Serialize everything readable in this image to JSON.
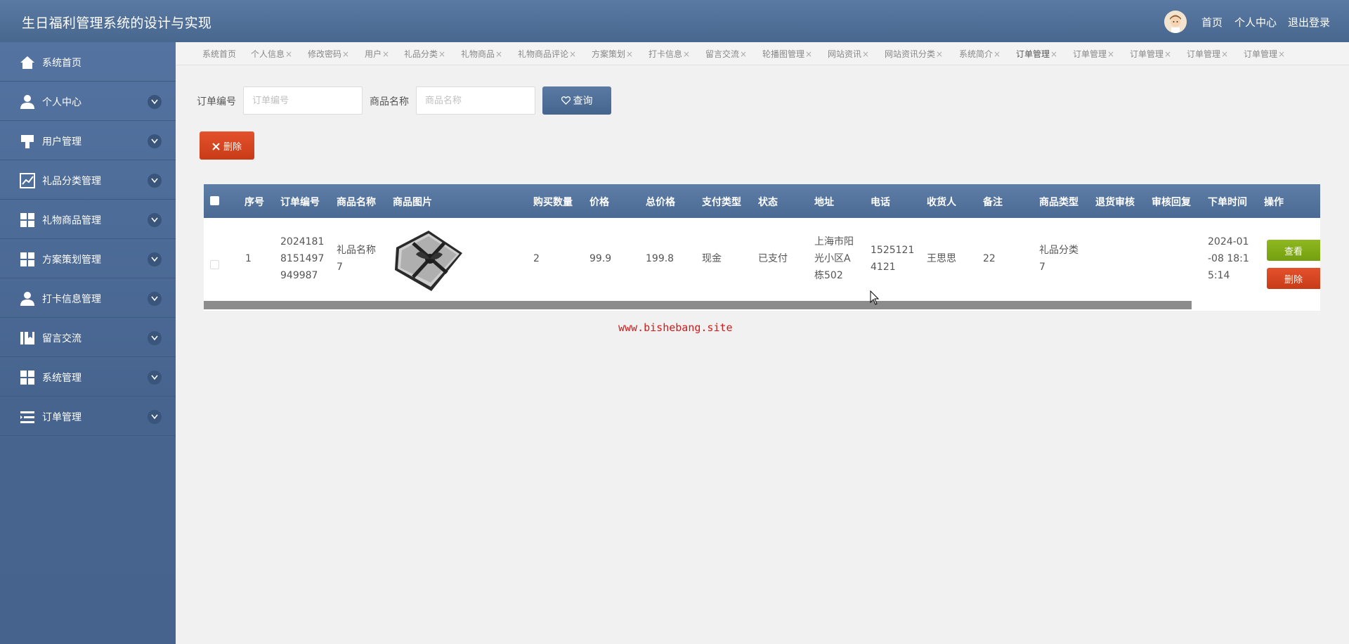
{
  "header": {
    "app_title": "生日福利管理系统的设计与实现",
    "nav": [
      "首页",
      "个人中心",
      "退出登录"
    ]
  },
  "sidebar": {
    "items": [
      {
        "label": "系统首页",
        "icon": "home-icon",
        "expandable": false
      },
      {
        "label": "个人中心",
        "icon": "user-icon",
        "expandable": true
      },
      {
        "label": "用户管理",
        "icon": "brush-icon",
        "expandable": true
      },
      {
        "label": "礼品分类管理",
        "icon": "chart-icon",
        "expandable": true
      },
      {
        "label": "礼物商品管理",
        "icon": "grid-icon",
        "expandable": true
      },
      {
        "label": "方案策划管理",
        "icon": "grid-icon",
        "expandable": true
      },
      {
        "label": "打卡信息管理",
        "icon": "user-icon",
        "expandable": true
      },
      {
        "label": "留言交流",
        "icon": "book-icon",
        "expandable": true
      },
      {
        "label": "系统管理",
        "icon": "grid-icon",
        "expandable": true
      },
      {
        "label": "订单管理",
        "icon": "list-icon",
        "expandable": true
      }
    ]
  },
  "tabs": [
    {
      "label": "系统首页",
      "closable": false
    },
    {
      "label": "个人信息",
      "closable": true
    },
    {
      "label": "修改密码",
      "closable": true
    },
    {
      "label": "用户",
      "closable": true
    },
    {
      "label": "礼品分类",
      "closable": true
    },
    {
      "label": "礼物商品",
      "closable": true
    },
    {
      "label": "礼物商品评论",
      "closable": true
    },
    {
      "label": "方案策划",
      "closable": true
    },
    {
      "label": "打卡信息",
      "closable": true
    },
    {
      "label": "留言交流",
      "closable": true
    },
    {
      "label": "轮播图管理",
      "closable": true
    },
    {
      "label": "网站资讯",
      "closable": true
    },
    {
      "label": "网站资讯分类",
      "closable": true
    },
    {
      "label": "系统简介",
      "closable": true
    },
    {
      "label": "订单管理",
      "closable": true,
      "active": true
    },
    {
      "label": "订单管理",
      "closable": true
    },
    {
      "label": "订单管理",
      "closable": true
    },
    {
      "label": "订单管理",
      "closable": true
    },
    {
      "label": "订单管理",
      "closable": true
    }
  ],
  "tab_close_glyph": "×",
  "search": {
    "order_no_label": "订单编号",
    "order_no_placeholder": "订单编号",
    "order_no_value": "",
    "product_label": "商品名称",
    "product_placeholder": "商品名称",
    "product_value": "",
    "query_label": "查询",
    "query_icon": "heart-icon"
  },
  "toolbar": {
    "delete_label": "删除",
    "delete_icon": "close-icon"
  },
  "table": {
    "columns": [
      "序号",
      "订单编号",
      "商品名称",
      "商品图片",
      "购买数量",
      "价格",
      "总价格",
      "支付类型",
      "状态",
      "地址",
      "电话",
      "收货人",
      "备注",
      "商品类型",
      "退货审核",
      "审核回复",
      "下单时间",
      "操作"
    ],
    "rows": [
      {
        "index": "1",
        "order_no": [
          "2024181",
          "8151497",
          "949987"
        ],
        "product_name": [
          "礼品名称",
          "7"
        ],
        "quantity": "2",
        "price": "99.9",
        "total": "199.8",
        "pay_type": "现金",
        "status": "已支付",
        "address": [
          "上海市阳",
          "光小区A",
          "栋502"
        ],
        "phone": [
          "1525121",
          "4121"
        ],
        "receiver": "王思思",
        "remark": "22",
        "category": [
          "礼品分类",
          "7"
        ],
        "return_review": "",
        "review_reply": "",
        "order_time": [
          "2024-01",
          "-08 18:1",
          "5:14"
        ],
        "actions": {
          "view": "查看",
          "delete": "删除"
        }
      }
    ]
  },
  "watermark": "www.bishebang.site",
  "colors": {
    "header": "#4f6f98",
    "sidebar": "#4d6b96",
    "danger": "#d5441f",
    "success": "#84ad18",
    "watermark": "#d11b1b"
  }
}
